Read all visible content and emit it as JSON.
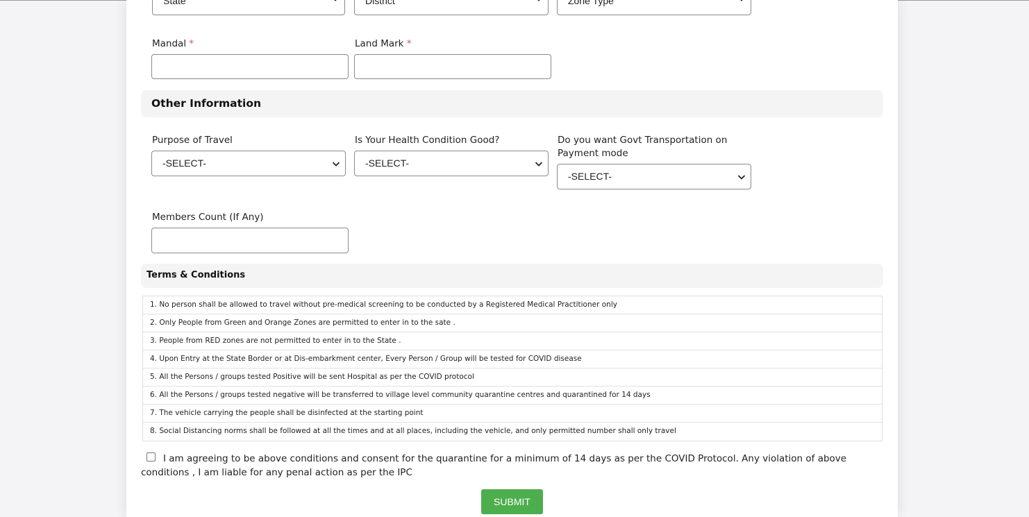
{
  "address_row": {
    "state_select": "State",
    "district_select": "District",
    "zone_type_select": "Zone Type"
  },
  "mandal": {
    "label": "Mandal",
    "required_mark": "*",
    "value": ""
  },
  "land_mark": {
    "label": "Land Mark",
    "required_mark": "*",
    "value": ""
  },
  "other_info": {
    "title": "Other Information",
    "purpose_of_travel": {
      "label": "Purpose of Travel",
      "selected": "-SELECT-"
    },
    "health_condition": {
      "label": "Is Your Health Condition Good?",
      "selected": "-SELECT-"
    },
    "govt_transport": {
      "label": "Do you want Govt Transportation on Payment mode",
      "selected": "-SELECT-"
    },
    "members_count": {
      "label": "Members Count (If Any)",
      "value": ""
    }
  },
  "terms": {
    "title": "Terms & Conditions",
    "items": [
      "1. No person shall be allowed to travel without pre-medical screening to be conducted by a Registered Medical Practitioner only",
      "2. Only People from Green and Orange Zones are permitted to enter in to the sate .",
      "3. People from RED zones are not permitted to enter in to the State .",
      "4. Upon Entry at the State Border or at Dis-embarkment center, Every Person / Group will be tested for COVID disease",
      "5. All the Persons / groups tested Positive will be sent Hospital as per the COVID protocol",
      "6. All the Persons / groups tested negative will be transferred to village level community quarantine centres and quarantined for 14 days",
      "7. The vehicle carrying the people shall be disinfected at the starting point",
      "8. Social Distancing norms shall be followed at all the times and at all places, including the vehicle, and only permitted number shall only travel"
    ]
  },
  "consent": {
    "checked": false,
    "text": "I am agreeing to be above conditions and consent for the quarantine for a minimum of 14 days as per the COVID Protocol. Any violation of above conditions , I am liable for any penal action as per the IPC"
  },
  "submit_label": "SUBMIT",
  "colors": {
    "submit_bg": "#4cae4c",
    "required": "#d9534f",
    "section_bg": "#f4f4f4"
  }
}
